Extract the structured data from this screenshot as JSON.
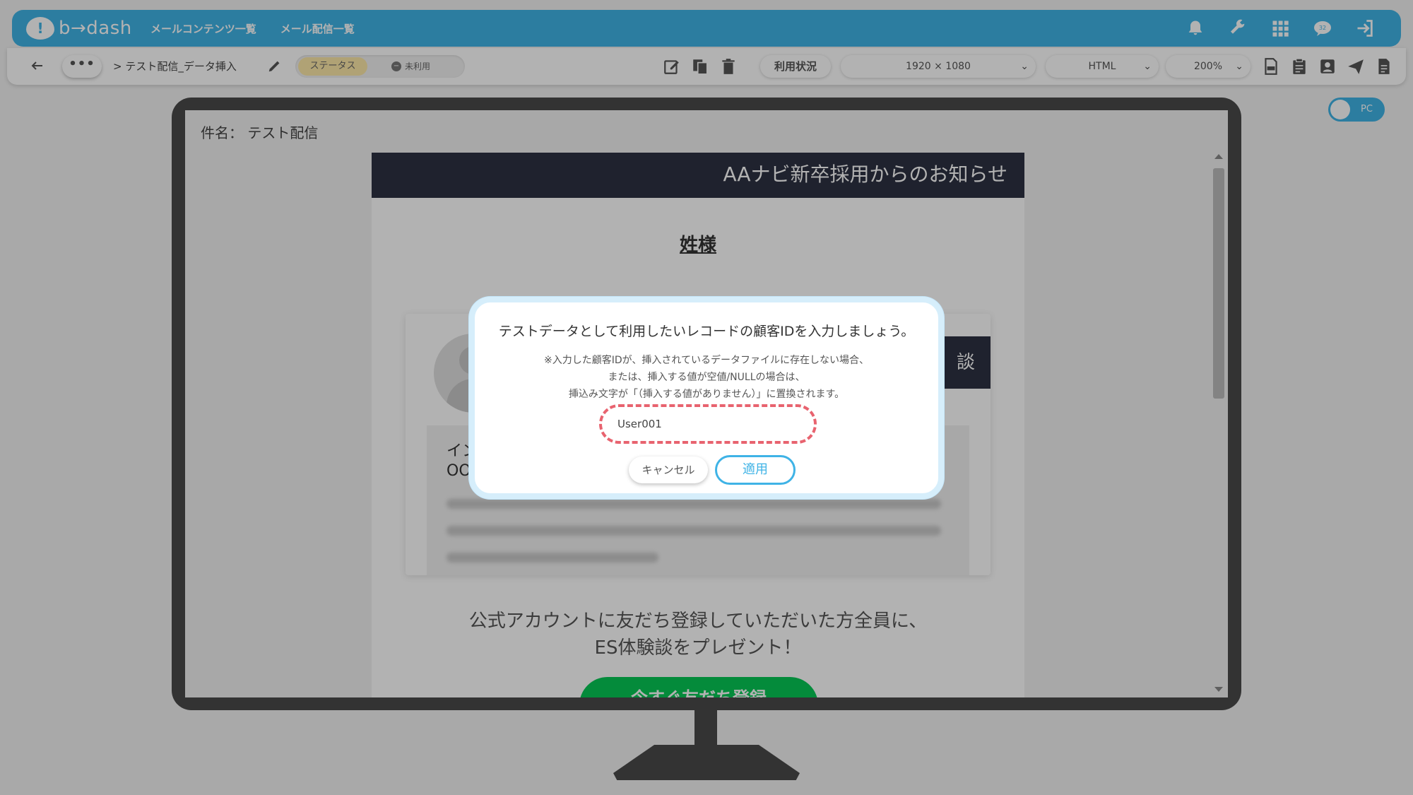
{
  "app": {
    "logo_text": "b→dash",
    "nav": [
      "メールコンテンツ一覧",
      "メール配信一覧"
    ],
    "badge_count": "32"
  },
  "toolbar": {
    "breadcrumb_sep": ">",
    "breadcrumb_title": "テスト配信_データ挿入",
    "status_label": "ステータス",
    "status_value": "未利用",
    "usage_label": "利用状況",
    "resolution": "1920 × 1080",
    "format": "HTML",
    "zoom": "200%"
  },
  "preview": {
    "toggle_label": "PC",
    "subject_label": "件名：",
    "subject_value": "テスト配信",
    "email_header": "AAナビ新卒採用からのお知らせ",
    "recipient_name": "姓様",
    "card_banner": "談",
    "quote_line1": "イン",
    "quote_line2": "OO",
    "promo_line1": "公式アカウントに友だち登録していただいた方全員に、",
    "promo_line2": "ES体験談をプレゼント！",
    "cta_label": "今すぐ友だち登録"
  },
  "modal": {
    "title": "テストデータとして利用したいレコードの顧客IDを入力しましょう。",
    "note_line1": "※入力した顧客IDが、挿入されているデータファイルに存在しない場合、",
    "note_line2": "または、挿入する値が空値/NULLの場合は、",
    "note_line3": "挿込み文字が「（挿入する値がありません）」に置換されます。",
    "input_value": "User001",
    "cancel_label": "キャンセル",
    "apply_label": "適用"
  },
  "colors": {
    "brand": "#3fb3e6",
    "dark_header": "#2d3242",
    "highlight": "#e8636f",
    "cta_green": "#06c755"
  }
}
